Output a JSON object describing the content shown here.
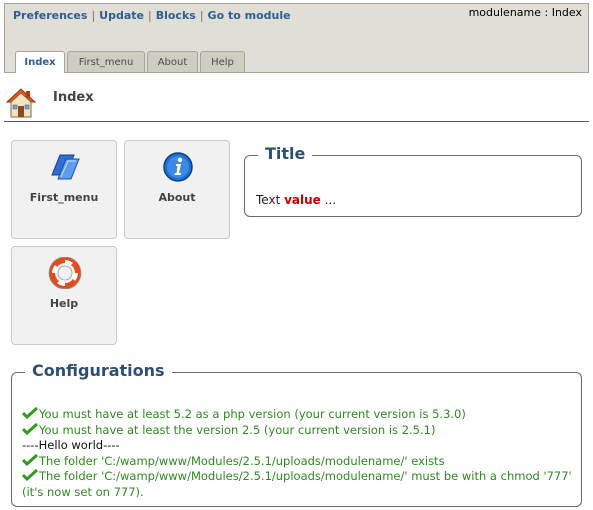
{
  "topbar": {
    "links": [
      "Preferences",
      "Update",
      "Blocks",
      "Go to module"
    ],
    "separator": "|",
    "module_title": "modulename : Index",
    "tabs": [
      "Index",
      "First_menu",
      "About",
      "Help"
    ],
    "active_tab": 0
  },
  "header": {
    "icon": "home-icon",
    "title": "Index"
  },
  "shortcuts": [
    {
      "label": "First_menu",
      "icon": "folder-icon"
    },
    {
      "label": "About",
      "icon": "info-icon"
    },
    {
      "label": "Help",
      "icon": "lifebuoy-icon"
    }
  ],
  "title_box": {
    "legend": "Title",
    "text_prefix": "Text",
    "value": "value",
    "text_suffix": "..."
  },
  "configurations": {
    "legend": "Configurations",
    "lines": [
      {
        "text": "You must have at least 5.2 as a php version (your current version is 5.3.0)",
        "status": "ok"
      },
      {
        "text": "You must have at least the version 2.5 (your current version is 2.5.1)",
        "status": "ok"
      },
      {
        "text": "----Hello world----",
        "status": "plain"
      },
      {
        "text": "The folder 'C:/wamp/www/Modules/2.5.1/uploads/modulename/' exists",
        "status": "ok"
      },
      {
        "text": "The folder 'C:/wamp/www/Modules/2.5.1/uploads/modulename/' must be with a chmod '777' (it's now set on 777).",
        "status": "ok"
      }
    ]
  },
  "colors": {
    "link": "#2f5e92",
    "legend": "#2d4f72",
    "ok_text": "#2e8a20",
    "value_text": "#cc0000",
    "topbar_bg": "#e0ded6"
  }
}
